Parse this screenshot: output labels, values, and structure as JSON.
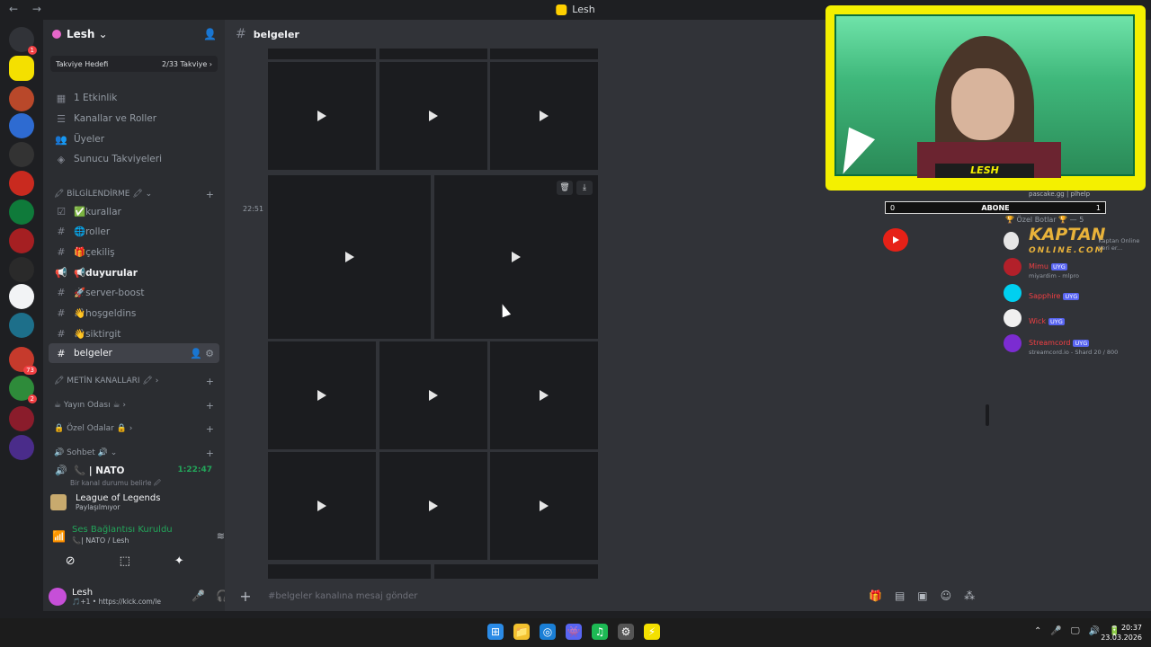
{
  "titlebar": {
    "back": "←",
    "forward": "→",
    "title": "Lesh"
  },
  "rail": {
    "servers": [
      {
        "name": "discord-home",
        "color": "#313338",
        "badge": "1"
      },
      {
        "name": "server-lesh",
        "color": "#f4e000",
        "badge": ""
      },
      {
        "name": "server-2",
        "color": "#b9482a",
        "badge": ""
      },
      {
        "name": "server-3",
        "color": "#2e6bd1",
        "badge": ""
      },
      {
        "name": "server-4",
        "color": "#333333",
        "badge": ""
      },
      {
        "name": "server-5",
        "color": "#c92a1f",
        "badge": ""
      },
      {
        "name": "server-6",
        "color": "#0f7a3a",
        "badge": ""
      },
      {
        "name": "server-7",
        "color": "#a51f22",
        "badge": ""
      },
      {
        "name": "server-8",
        "color": "#2a2a2a",
        "badge": ""
      },
      {
        "name": "server-9",
        "color": "#f2f3f5",
        "badge": ""
      },
      {
        "name": "server-10",
        "color": "#1d6f8a",
        "badge": ""
      },
      {
        "name": "server-11",
        "color": "#c63a2c",
        "badge": "73"
      },
      {
        "name": "server-12",
        "color": "#2e8b3a",
        "badge": "2"
      },
      {
        "name": "server-13",
        "color": "#8a1c2b",
        "badge": ""
      },
      {
        "name": "server-14",
        "color": "#4a2c8a",
        "badge": ""
      }
    ]
  },
  "sidebar": {
    "guild_name": "Lesh",
    "guild_chevron": "⌄",
    "boost_goal": "Takviye Hedefi",
    "boost_count": "2/33 Takviye",
    "boost_chevron": "›",
    "items": [
      {
        "icon": "▦",
        "label": "1 Etkinlik"
      },
      {
        "icon": "☰",
        "label": "Kanallar ve Roller"
      },
      {
        "icon": "👥",
        "label": "Üyeler"
      },
      {
        "icon": "◈",
        "label": "Sunucu Takviyeleri"
      }
    ],
    "category_info": "🖍 BİLGİLENDİRME 🖍 ⌄",
    "channels": [
      {
        "icon": "☑",
        "label": "✅kurallar"
      },
      {
        "icon": "#",
        "label": "🌐roller"
      },
      {
        "icon": "#",
        "label": "🎁çekiliş"
      },
      {
        "icon": "📢",
        "label": "📢duyurular"
      },
      {
        "icon": "#",
        "label": "🚀server-boost"
      },
      {
        "icon": "#",
        "label": "👋hoşgeldins"
      },
      {
        "icon": "#",
        "label": "👋siktirgit"
      },
      {
        "icon": "#",
        "label": "belgeler"
      }
    ],
    "category_metin": "🖍 METİN KANALLARI 🖍 ›",
    "category_yayin": "☕ Yayın Odası ☕ ›",
    "category_ozel": "🔒 Özel Odalar 🔒 ›",
    "category_sohbet": "🔊 Sohbet 🔊 ⌄",
    "voice_channel": "📞 | NATO",
    "voice_timer": "1:22:47",
    "voice_status": "Bir kanal durumu belirle 🖉",
    "plus": "+"
  },
  "activity": {
    "title": "League of Legends",
    "subtitle": "Paylaşılmıyor"
  },
  "voice": {
    "title": "Ses Bağlantısı Kuruldu",
    "subtitle": "📞| NATO / Lesh"
  },
  "user": {
    "name": "Lesh",
    "status": "🎵+1 • https://kick.com/le"
  },
  "main": {
    "channel_hash": "#",
    "channel_name": "belgeler",
    "timestamp": "22:51",
    "composer_placeholder": "#belgeler kanalına mesaj gönder",
    "composer_plus": "+"
  },
  "overlay": {
    "streamer_name": "LESH",
    "sub_left": "0",
    "sub_label": "ABONE",
    "sub_right": "1"
  },
  "members": {
    "top_entry": "pascake.gg | plhelp",
    "category": "🏆 Özel Botlar 🏆 — 5",
    "list": [
      {
        "name": "",
        "sub": "Kaptan Online Veri er...",
        "color": "#e6e6e6",
        "tag": ""
      },
      {
        "name": "Mimu",
        "sub": "miyardim - mlpro",
        "color": "#b3202a",
        "tag": "UYG"
      },
      {
        "name": "Sapphire",
        "sub": "",
        "color": "#00d0f0",
        "tag": "UYG"
      },
      {
        "name": "Wick",
        "sub": "",
        "color": "#f0f0f0",
        "tag": "UYG"
      },
      {
        "name": "Streamcord",
        "sub": "streamcord.io - Shard 20 / 800",
        "color": "#7b2cd1",
        "tag": "UYG"
      }
    ],
    "kaptan_main": "KAPTAN",
    "kaptan_sub": "ONLINE.COM"
  },
  "taskbar": {
    "apps": [
      "⊞",
      "📁",
      "◎",
      "👾",
      "♫",
      "⚙",
      "⚡"
    ],
    "tray": [
      "⌃",
      "🎤",
      "🖵",
      "🔊",
      "🔋"
    ],
    "time": "20:37",
    "date": "23.03.2026"
  }
}
